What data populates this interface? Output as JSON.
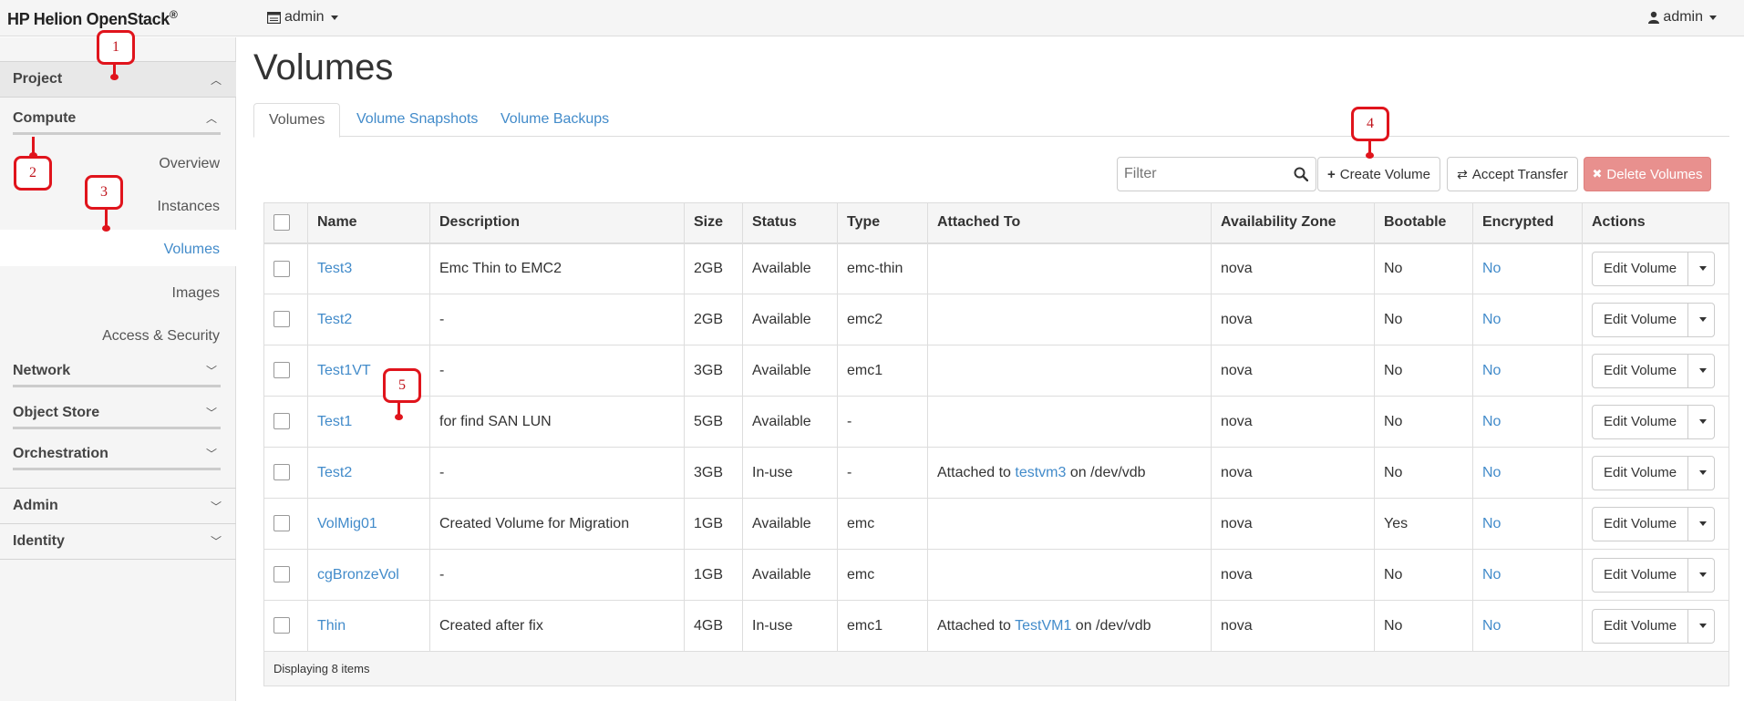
{
  "topbar": {
    "brand": "HP Helion OpenStack",
    "brand_mark": "®",
    "project_selector": "admin",
    "user_menu": "admin"
  },
  "sidebar": {
    "project": "Project",
    "compute": "Compute",
    "compute_items": [
      "Overview",
      "Instances",
      "Volumes",
      "Images",
      "Access & Security"
    ],
    "network": "Network",
    "object_store": "Object Store",
    "orchestration": "Orchestration",
    "admin": "Admin",
    "identity": "Identity"
  },
  "page": {
    "title": "Volumes",
    "tabs": [
      "Volumes",
      "Volume Snapshots",
      "Volume Backups"
    ]
  },
  "toolbar": {
    "filter_placeholder": "Filter",
    "create_label": "Create Volume",
    "accept_label": "Accept Transfer",
    "delete_label": "Delete Volumes"
  },
  "table": {
    "headers": [
      "Name",
      "Description",
      "Size",
      "Status",
      "Type",
      "Attached To",
      "Availability Zone",
      "Bootable",
      "Encrypted",
      "Actions"
    ],
    "rows": [
      {
        "name": "Test3",
        "description": "Emc Thin to EMC2",
        "size": "2GB",
        "status": "Available",
        "type": "emc-thin",
        "attached_prefix": "",
        "attached_link": "",
        "attached_suffix": "",
        "zone": "nova",
        "bootable": "No",
        "encrypted": "No",
        "action": "Edit Volume"
      },
      {
        "name": "Test2",
        "description": "-",
        "size": "2GB",
        "status": "Available",
        "type": "emc2",
        "attached_prefix": "",
        "attached_link": "",
        "attached_suffix": "",
        "zone": "nova",
        "bootable": "No",
        "encrypted": "No",
        "action": "Edit Volume"
      },
      {
        "name": "Test1VT",
        "description": "-",
        "size": "3GB",
        "status": "Available",
        "type": "emc1",
        "attached_prefix": "",
        "attached_link": "",
        "attached_suffix": "",
        "zone": "nova",
        "bootable": "No",
        "encrypted": "No",
        "action": "Edit Volume"
      },
      {
        "name": "Test1",
        "description": "for find SAN LUN",
        "size": "5GB",
        "status": "Available",
        "type": "-",
        "attached_prefix": "",
        "attached_link": "",
        "attached_suffix": "",
        "zone": "nova",
        "bootable": "No",
        "encrypted": "No",
        "action": "Edit Volume"
      },
      {
        "name": "Test2",
        "description": "-",
        "size": "3GB",
        "status": "In-use",
        "type": "-",
        "attached_prefix": "Attached to ",
        "attached_link": "testvm3",
        "attached_suffix": " on /dev/vdb",
        "zone": "nova",
        "bootable": "No",
        "encrypted": "No",
        "action": "Edit Volume"
      },
      {
        "name": "VolMig01",
        "description": "Created Volume for Migration",
        "size": "1GB",
        "status": "Available",
        "type": "emc",
        "attached_prefix": "",
        "attached_link": "",
        "attached_suffix": "",
        "zone": "nova",
        "bootable": "Yes",
        "encrypted": "No",
        "action": "Edit Volume"
      },
      {
        "name": "cgBronzeVol",
        "description": "-",
        "size": "1GB",
        "status": "Available",
        "type": "emc",
        "attached_prefix": "",
        "attached_link": "",
        "attached_suffix": "",
        "zone": "nova",
        "bootable": "No",
        "encrypted": "No",
        "action": "Edit Volume"
      },
      {
        "name": "Thin",
        "description": "Created after fix",
        "size": "4GB",
        "status": "In-use",
        "type": "emc1",
        "attached_prefix": "Attached to ",
        "attached_link": "TestVM1",
        "attached_suffix": " on /dev/vdb",
        "zone": "nova",
        "bootable": "No",
        "encrypted": "No",
        "action": "Edit Volume"
      }
    ],
    "footer": "Displaying 8 items"
  },
  "callouts": [
    "1",
    "2",
    "3",
    "4",
    "5"
  ],
  "colors": {
    "link": "#428bca",
    "callout": "#e0141c",
    "delete": "#e8908e"
  }
}
